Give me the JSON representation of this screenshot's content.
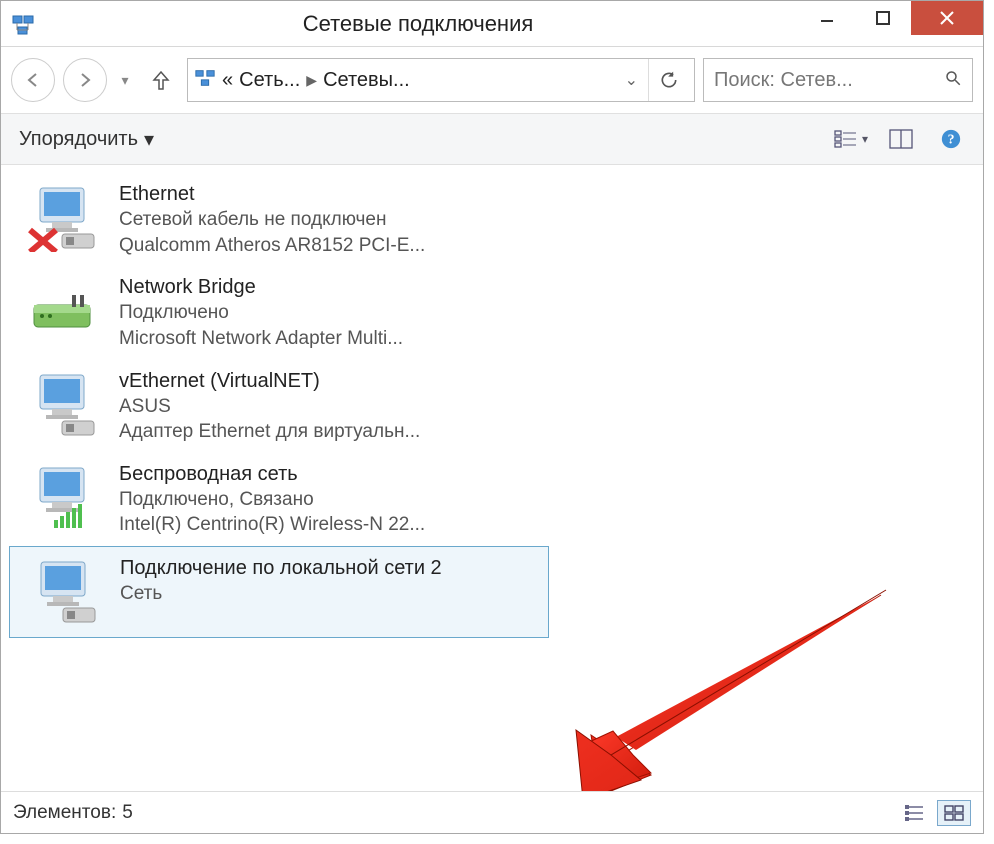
{
  "window": {
    "title": "Сетевые подключения"
  },
  "breadcrumb": {
    "leading": "«",
    "part1": "Сеть...",
    "part2": "Сетевы..."
  },
  "search": {
    "placeholder": "Поиск: Сетев..."
  },
  "toolbar": {
    "organize_label": "Упорядочить"
  },
  "connections": [
    {
      "name": "Ethernet",
      "status": "Сетевой кабель не подключен",
      "device": "Qualcomm Atheros AR8152 PCI-E...",
      "icon": "ethernet-disconnected"
    },
    {
      "name": "Network Bridge",
      "status": "Подключено",
      "device": "Microsoft Network Adapter Multi...",
      "icon": "bridge"
    },
    {
      "name": "vEthernet (VirtualNET)",
      "status": "ASUS",
      "device": "Адаптер Ethernet для виртуальн...",
      "icon": "ethernet"
    },
    {
      "name": "Беспроводная сеть",
      "status": "Подключено, Связано",
      "device": "Intel(R) Centrino(R) Wireless-N 22...",
      "icon": "wifi"
    },
    {
      "name": "Подключение по локальной сети 2",
      "status": "",
      "device": "Сеть",
      "icon": "ethernet",
      "selected": true
    }
  ],
  "statusbar": {
    "label": "Элементов:",
    "count": "5"
  }
}
